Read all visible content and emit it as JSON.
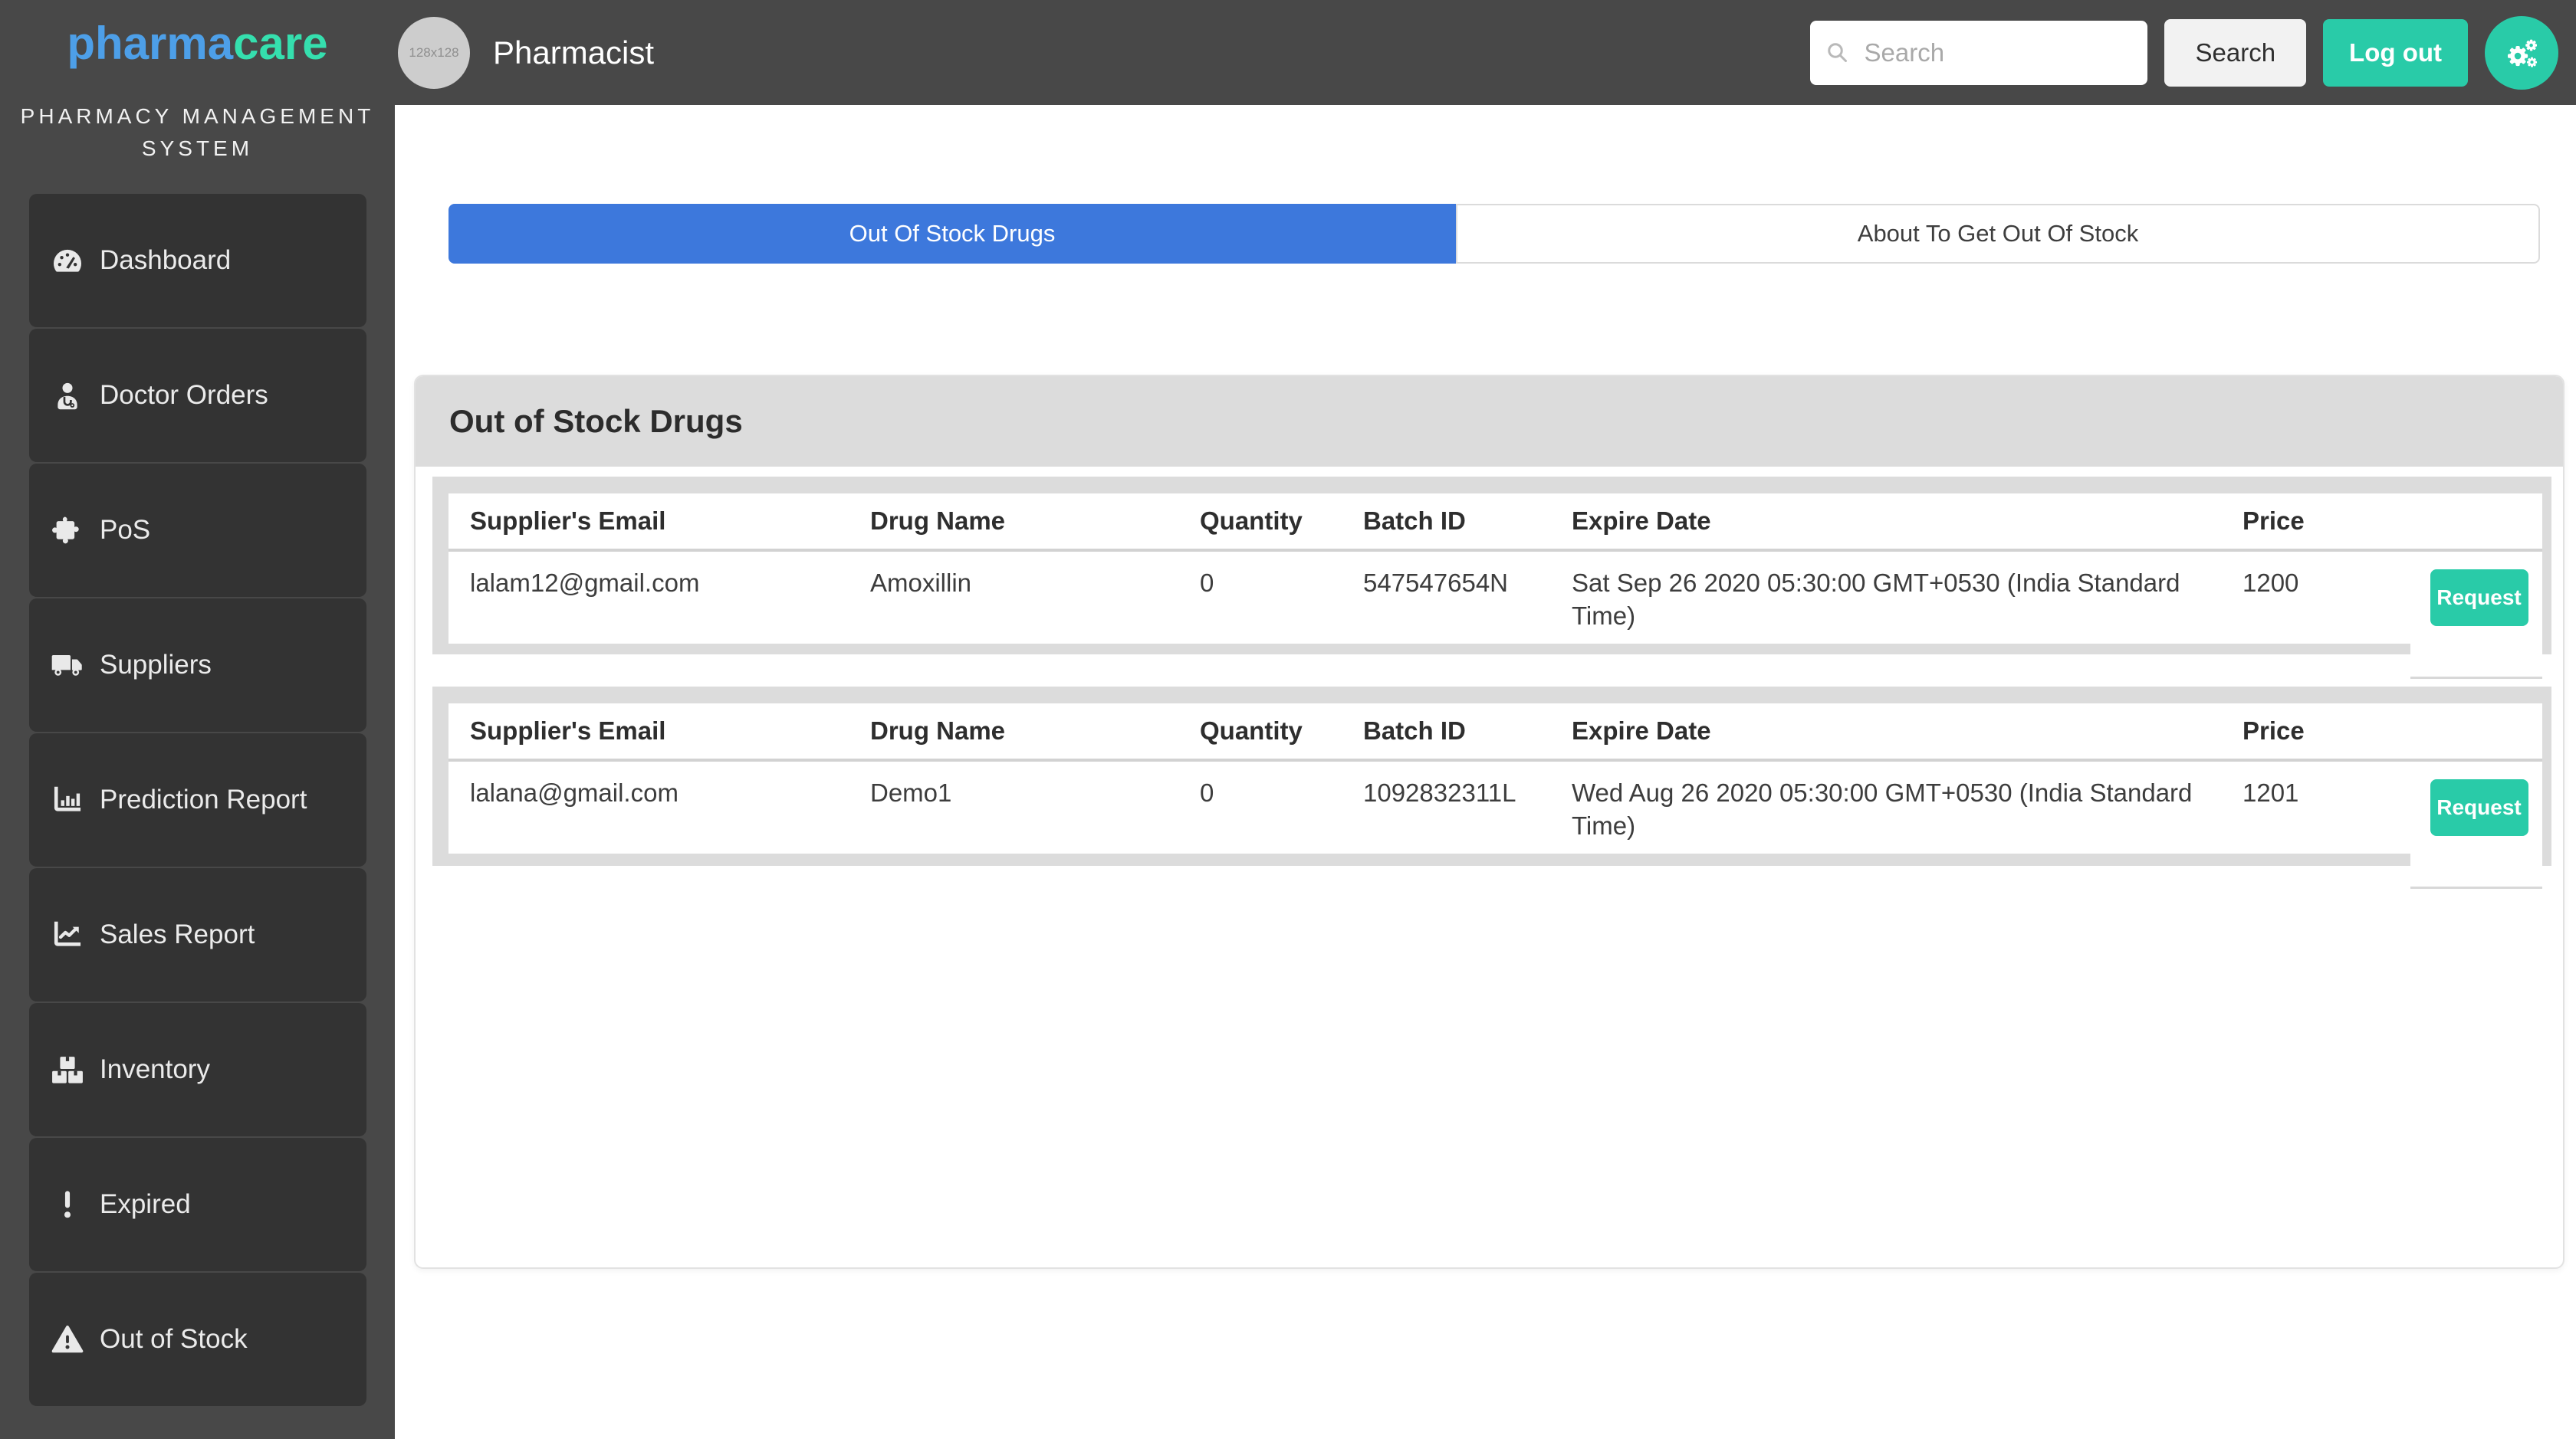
{
  "colors": {
    "accent_teal": "#29cba8",
    "accent_blue": "#3d78dc",
    "dark_bg": "#484848",
    "nav_item_bg": "#333333",
    "panel_gray": "#dcdcdc",
    "logo_blue": "#4d9fe8",
    "logo_teal": "#35dfae"
  },
  "brand": {
    "logo_blue": "pharma",
    "logo_teal": "care",
    "tagline_line1": "PHARMACY MANAGEMENT",
    "tagline_line2": "SYSTEM"
  },
  "header": {
    "user_role": "Pharmacist",
    "avatar_placeholder": "128x128",
    "search_placeholder": "Search",
    "search_button_label": "Search",
    "logout_button_label": "Log out"
  },
  "sidebar": {
    "items": [
      {
        "label": "Dashboard",
        "icon": "gauge-icon"
      },
      {
        "label": "Doctor Orders",
        "icon": "user-doctor-icon"
      },
      {
        "label": "PoS",
        "icon": "puzzle-piece-icon"
      },
      {
        "label": "Suppliers",
        "icon": "truck-icon"
      },
      {
        "label": "Prediction Report",
        "icon": "chart-column-icon"
      },
      {
        "label": "Sales Report",
        "icon": "chart-line-icon"
      },
      {
        "label": "Inventory",
        "icon": "boxes-icon"
      },
      {
        "label": "Expired",
        "icon": "exclamation-icon"
      },
      {
        "label": "Out of Stock",
        "icon": "warning-triangle-icon"
      }
    ]
  },
  "tabs": {
    "active": "Out Of Stock Drugs",
    "inactive": "About To Get Out Of Stock"
  },
  "content": {
    "card_title": "Out of Stock Drugs"
  },
  "table": {
    "headers": [
      "Supplier's Email",
      "Drug Name",
      "Quantity",
      "Batch ID",
      "Expire Date",
      "Price"
    ],
    "action_label": "Request",
    "rows": [
      {
        "supplier_email": "lalam12@gmail.com",
        "drug_name": "Amoxillin",
        "quantity": "0",
        "batch_id": "547547654N",
        "expire_date": "Sat Sep 26 2020 05:30:00 GMT+0530 (India Standard Time)",
        "price": "1200"
      },
      {
        "supplier_email": "lalana@gmail.com",
        "drug_name": "Demo1",
        "quantity": "0",
        "batch_id": "1092832311L",
        "expire_date": "Wed Aug 26 2020 05:30:00 GMT+0530 (India Standard Time)",
        "price": "1201"
      }
    ]
  }
}
